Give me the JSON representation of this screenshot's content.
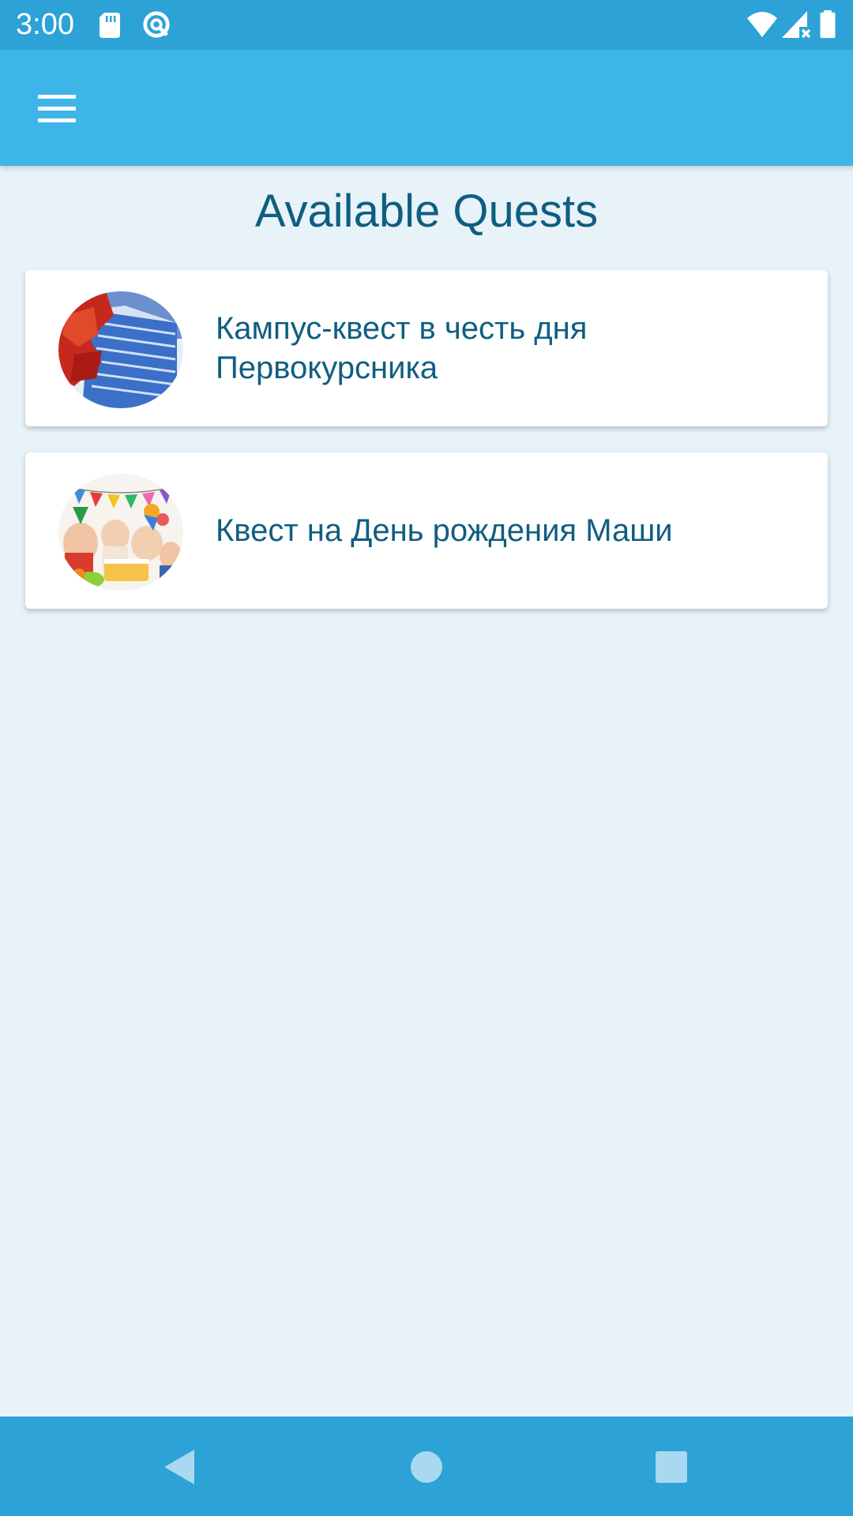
{
  "status_bar": {
    "time": "3:00",
    "icons": [
      "sd-card-icon",
      "data-saver-icon",
      "wifi-icon",
      "signal-no-data-icon",
      "battery-icon"
    ]
  },
  "app_bar": {
    "menu_icon": "hamburger-menu-icon"
  },
  "main": {
    "title": "Available Quests",
    "quests": [
      {
        "title": "Кампус-квест в честь дня Первокурсника",
        "image": "campus-building-autumn-image"
      },
      {
        "title": "Квест на День рождения Маши",
        "image": "birthday-party-kids-image"
      }
    ]
  },
  "nav_bar": {
    "buttons": [
      "back-triangle-icon",
      "home-circle-icon",
      "recents-square-icon"
    ]
  },
  "colors": {
    "status_bar": "#2ca2d7",
    "app_bar": "#3eb5e8",
    "background": "#e8f3f9",
    "text": "#0f5e80",
    "nav_bar": "#2ca2d7"
  }
}
